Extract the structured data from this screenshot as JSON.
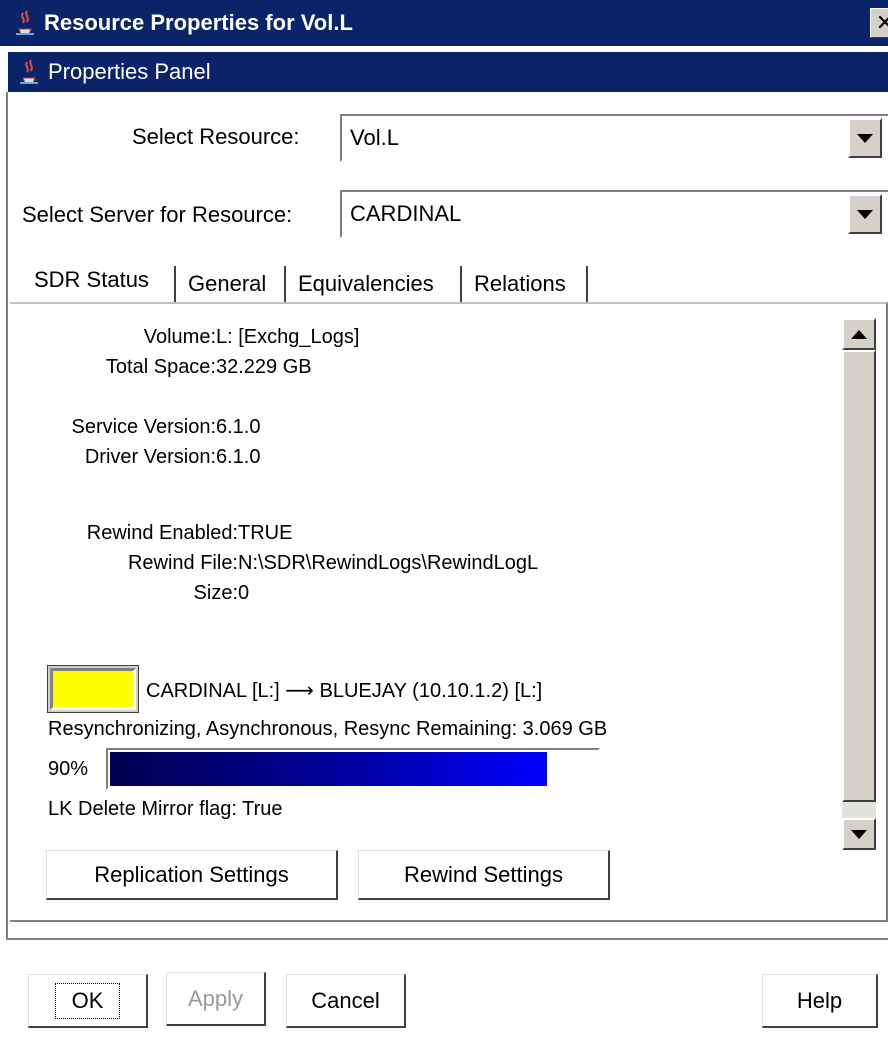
{
  "window": {
    "title": "Resource Properties for Vol.L",
    "close_glyph": "✕"
  },
  "panel": {
    "title": "Properties Panel"
  },
  "select_resource": {
    "label": "Select Resource:",
    "value": "Vol.L"
  },
  "select_server": {
    "label": "Select Server for Resource:",
    "value": "CARDINAL"
  },
  "tabs": [
    {
      "label": "SDR Status",
      "active": true
    },
    {
      "label": "General"
    },
    {
      "label": "Equivalencies"
    },
    {
      "label": "Relations"
    }
  ],
  "sdr_status": {
    "volume": {
      "label": "Volume:",
      "value": "L: [Exchg_Logs]"
    },
    "total_space": {
      "label": "Total Space:",
      "value": "32.229 GB"
    },
    "service_version": {
      "label": "Service Version:",
      "value": "6.1.0"
    },
    "driver_version": {
      "label": "Driver Version:",
      "value": "6.1.0"
    },
    "rewind_enabled": {
      "label": "Rewind Enabled:",
      "value": "TRUE"
    },
    "rewind_file": {
      "label": "Rewind File:",
      "value": "N:\\SDR\\RewindLogs\\RewindLogL"
    },
    "size": {
      "label": "Size:",
      "value": "0"
    },
    "mirror": {
      "status_color": "#ffff00",
      "path": "CARDINAL [L:] ⟶ BLUEJAY (10.10.1.2) [L:]",
      "state": "Resynchronizing, Asynchronous, Resync Remaining: 3.069 GB",
      "progress_label": "90%",
      "progress_fraction": 0.9,
      "delete_flag": "LK Delete Mirror flag: True"
    },
    "buttons": {
      "replication": "Replication Settings",
      "rewind": "Rewind Settings"
    }
  },
  "dialog_buttons": {
    "ok": "OK",
    "apply": "Apply",
    "cancel": "Cancel",
    "help": "Help"
  },
  "icons": {
    "app": "java-cup-icon",
    "scroll_up": "arrow-up-icon",
    "scroll_down": "arrow-down-icon",
    "dropdown": "chevron-down-icon"
  },
  "colors": {
    "title_bar": "#0a246a",
    "progress": "#0000ff",
    "status_warning": "#ffff00"
  }
}
